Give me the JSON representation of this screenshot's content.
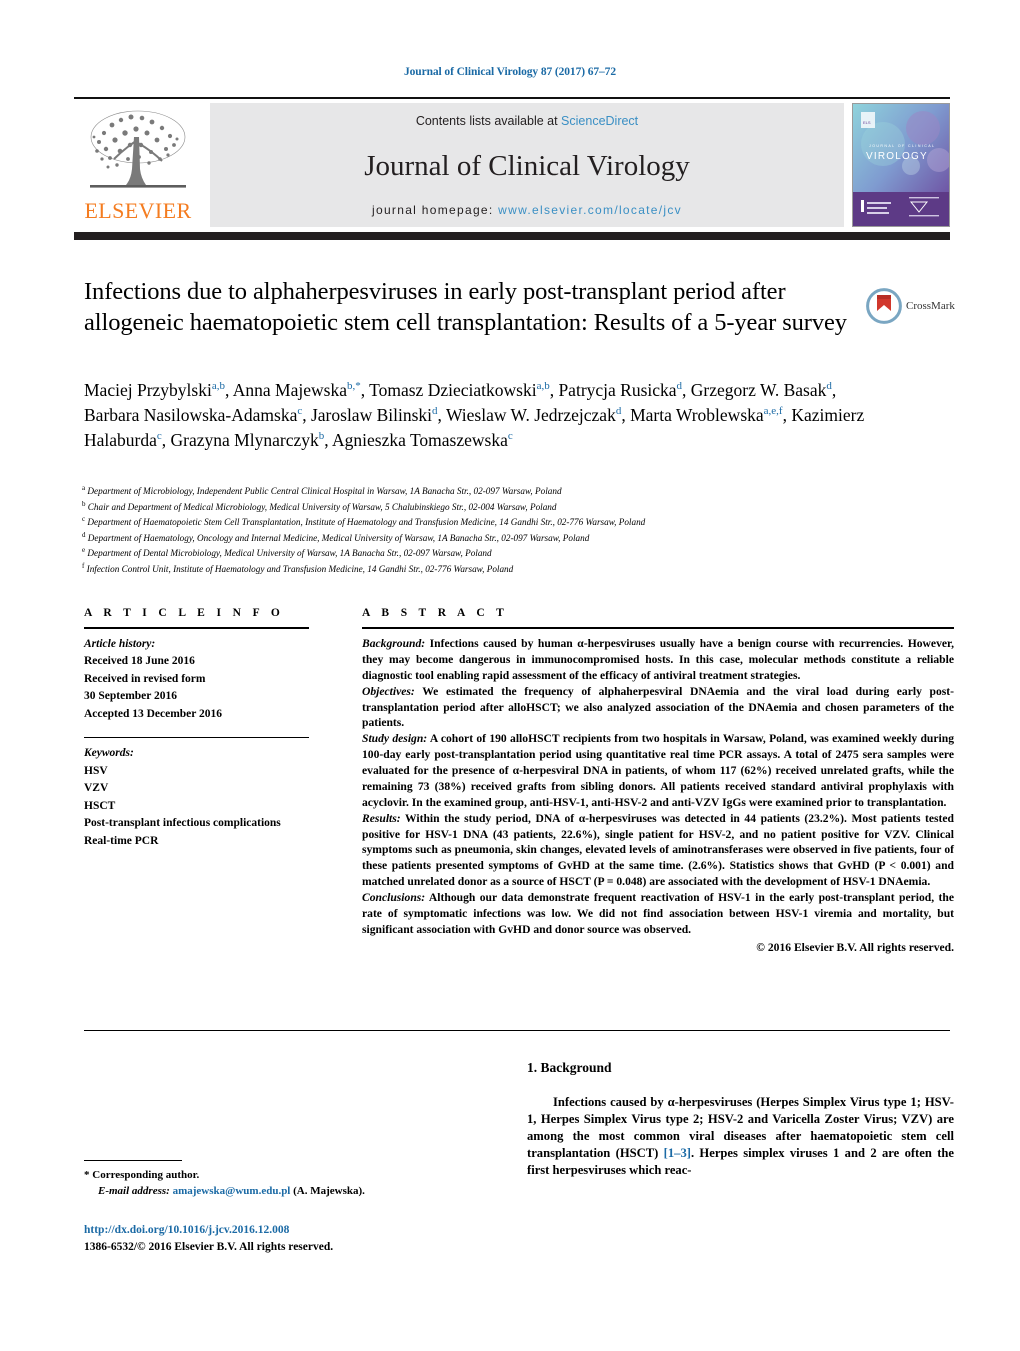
{
  "running_head": "Journal of Clinical Virology 87 (2017) 67–72",
  "masthead": {
    "publisher_name": "ELSEVIER",
    "contents_prefix": "Contents lists available at ",
    "contents_link": "ScienceDirect",
    "journal_title": "Journal of Clinical Virology",
    "homepage_prefix": "journal homepage: ",
    "homepage_url": "www.elsevier.com/locate/jcv",
    "cover_title": "VIROLOGY",
    "cover_kicker": "JOURNAL OF CLINICAL"
  },
  "crossmark": {
    "label": "CrossMark"
  },
  "article": {
    "title": "Infections due to alphaherpesviruses in early post-transplant period after allogeneic haematopoietic stem cell transplantation: Results of a 5-year survey",
    "authors_html": "Maciej Przybylski<sup>a,b</sup>, Anna Majewska<sup>b,*</sup>, Tomasz Dzieciatkowski<sup>a,b</sup>, Patrycja Rusicka<sup>d</sup>, Grzegorz W. Basak<sup>d</sup>, Barbara Nasilowska-Adamska<sup>c</sup>, Jaroslaw Bilinski<sup>d</sup>, Wieslaw W. Jedrzejczak<sup>d</sup>, Marta Wroblewska<sup>a,e,f</sup>, Kazimierz Halaburda<sup>c</sup>, Grazyna Mlynarczyk<sup>b</sup>, Agnieszka Tomaszewska<sup>c</sup>"
  },
  "affiliations": [
    {
      "mark": "a",
      "text": "Department of Microbiology, Independent Public Central Clinical Hospital in Warsaw, 1A Banacha Str., 02-097 Warsaw, Poland"
    },
    {
      "mark": "b",
      "text": "Chair and Department of Medical Microbiology, Medical University of Warsaw, 5 Chalubinskiego Str., 02-004 Warsaw, Poland"
    },
    {
      "mark": "c",
      "text": "Department of Haematopoietic Stem Cell Transplantation, Institute of Haematology and Transfusion Medicine, 14 Gandhi Str., 02-776 Warsaw, Poland"
    },
    {
      "mark": "d",
      "text": "Department of Haematology, Oncology and Internal Medicine, Medical University of Warsaw, 1A Banacha Str., 02-097 Warsaw, Poland"
    },
    {
      "mark": "e",
      "text": "Department of Dental Microbiology, Medical University of Warsaw, 1A Banacha Str., 02-097 Warsaw, Poland"
    },
    {
      "mark": "f",
      "text": "Infection Control Unit, Institute of Haematology and Transfusion Medicine, 14 Gandhi Str., 02-776 Warsaw, Poland"
    }
  ],
  "article_info": {
    "heading": "A R T I C L E    I N F O",
    "history_label": "Article history:",
    "history": [
      "Received 18 June 2016",
      "Received in revised form",
      "30 September 2016",
      "Accepted 13 December 2016"
    ],
    "keywords_label": "Keywords:",
    "keywords": [
      "HSV",
      "VZV",
      "HSCT",
      "Post-transplant infectious complications",
      "Real-time PCR"
    ]
  },
  "abstract": {
    "heading": "A B S T R A C T",
    "sections": [
      {
        "lead": "Background:",
        "text": " Infections caused by human α-herpesviruses usually have a benign course with recurrencies. However, they may become dangerous in immunocompromised hosts. In this case, molecular methods constitute a reliable diagnostic tool enabling rapid assessment of the efficacy of antiviral treatment strategies."
      },
      {
        "lead": "Objectives:",
        "text": " We estimated the frequency of alphaherpesviral DNAemia and the viral load during early post-transplantation period after alloHSCT; we also analyzed association of the DNAemia and chosen parameters of the patients."
      },
      {
        "lead": "Study design:",
        "text": " A cohort of 190 alloHSCT recipients from two hospitals in Warsaw, Poland, was examined weekly during 100-day early post-transplantation period using quantitative real time PCR assays. A total of 2475 sera samples were evaluated for the presence of α-herpesviral DNA in patients, of whom 117 (62%) received unrelated grafts, while the remaining 73 (38%) received grafts from sibling donors. All patients received standard antiviral prophylaxis with acyclovir. In the examined group, anti-HSV-1, anti-HSV-2 and anti-VZV IgGs were examined prior to transplantation."
      },
      {
        "lead": "Results:",
        "text": " Within the study period, DNA of α-herpesviruses was detected in 44 patients (23.2%). Most patients tested positive for HSV-1 DNA (43 patients, 22.6%), single patient for HSV-2, and no patient positive for VZV. Clinical symptoms such as pneumonia, skin changes, elevated levels of aminotransferases were observed in five patients, four of these patients presented symptoms of GvHD at the same time. (2.6%). Statistics shows that GvHD (P < 0.001) and matched unrelated donor as a source of HSCT (P = 0.048) are associated with the development of HSV-1 DNAemia."
      },
      {
        "lead": "Conclusions:",
        "text": " Although our data demonstrate frequent reactivation of HSV-1 in the early post-transplant period, the rate of symptomatic infections was low. We did not find association between HSV-1 viremia and mortality, but significant association with GvHD and donor source was observed."
      }
    ],
    "copyright": "© 2016 Elsevier B.V. All rights reserved."
  },
  "background": {
    "heading": "1. Background",
    "paragraph_pre": "Infections caused by α-herpesviruses (Herpes Simplex Virus type 1; HSV-1, Herpes Simplex Virus type 2; HSV-2 and Varicella Zoster Virus; VZV) are among the most common viral diseases after haematopoietic stem cell transplantation (HSCT) ",
    "reference": "[1–3]",
    "paragraph_post": ". Herpes simplex viruses 1 and 2 are often the first herpesviruses which reac-"
  },
  "footer": {
    "corresponding_marker": "*",
    "corresponding_label": "Corresponding author.",
    "email_label": "E-mail address:",
    "email": "amajewska@wum.edu.pl",
    "email_suffix": "(A. Majewska).",
    "doi_url": "http://dx.doi.org/10.1016/j.jcv.2016.12.008",
    "issn_line": "1386-6532/© 2016 Elsevier B.V. All rights reserved."
  },
  "colors": {
    "link_blue": "#1b6aa5",
    "science_direct_blue": "#3a8fc4",
    "elsevier_orange": "#F47C20",
    "band_grey": "#e7e7e8",
    "rule_black": "#231f20"
  }
}
